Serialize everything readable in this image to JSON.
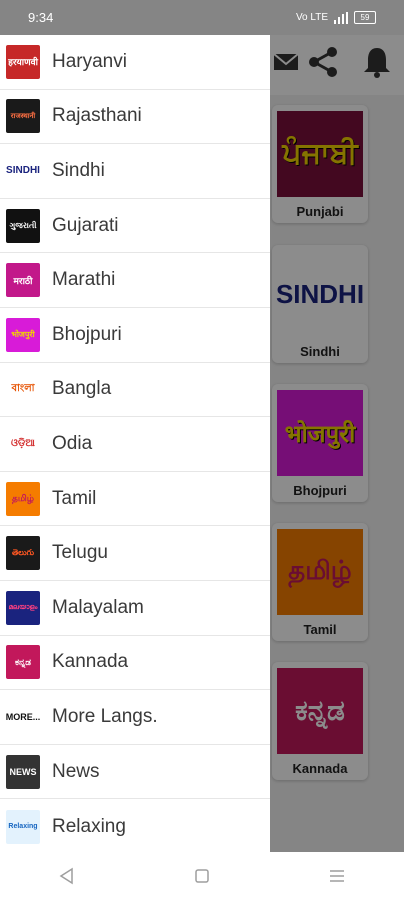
{
  "status_bar": {
    "time": "9:34",
    "signal_text": "Vo LTE",
    "battery_text": "59"
  },
  "drawer": {
    "items": [
      {
        "label": "Haryanvi",
        "icon": "haryanvi-icon",
        "icon_text": "हरयाणवी",
        "color": "#c62828"
      },
      {
        "label": "Rajasthani",
        "icon": "rajasthani-icon",
        "icon_text": "राजस्थानी",
        "color": "#1a1a1a"
      },
      {
        "label": "Sindhi",
        "icon": "sindhi-icon",
        "icon_text": "SINDHI",
        "color": "#ffffff"
      },
      {
        "label": "Gujarati",
        "icon": "gujarati-icon",
        "icon_text": "ગુજરાતી",
        "color": "#111111"
      },
      {
        "label": "Marathi",
        "icon": "marathi-icon",
        "icon_text": "मराठी",
        "color": "#c2188a"
      },
      {
        "label": "Bhojpuri",
        "icon": "bhojpuri-icon",
        "icon_text": "भोजपुरी",
        "color": "#d81bd8"
      },
      {
        "label": "Bangla",
        "icon": "bangla-icon",
        "icon_text": "বাংলা",
        "color": "#ffffff"
      },
      {
        "label": "Odia",
        "icon": "odia-icon",
        "icon_text": "ଓଡ଼ିଆ",
        "color": "#ffffff"
      },
      {
        "label": "Tamil",
        "icon": "tamil-icon",
        "icon_text": "தமிழ்",
        "color": "#f57c00"
      },
      {
        "label": "Telugu",
        "icon": "telugu-icon",
        "icon_text": "తెలుగు",
        "color": "#1a1a1a"
      },
      {
        "label": "Malayalam",
        "icon": "malayalam-icon",
        "icon_text": "മലയാളം",
        "color": "#1a237e"
      },
      {
        "label": "Kannada",
        "icon": "kannada-icon",
        "icon_text": "ಕನ್ನಡ",
        "color": "#c2185b"
      },
      {
        "label": "More Langs.",
        "icon": "more-langs-icon",
        "icon_text": "MORE...",
        "color": "#ffffff"
      },
      {
        "label": "News",
        "icon": "news-icon",
        "icon_text": "NEWS",
        "color": "#333333"
      },
      {
        "label": "Relaxing",
        "icon": "relaxing-icon",
        "icon_text": "Relaxing",
        "color": "#e3f2fd"
      }
    ]
  },
  "background": {
    "cards": [
      {
        "label": "Punjabi",
        "tile_text": "ਪੰਜਾਬੀ",
        "tile_color": "#7a0f3b",
        "text_color": "#f2d400"
      },
      {
        "label": "Sindhi",
        "tile_text": "SINDHI",
        "tile_color": "#ffffff",
        "text_color": "#1a237e"
      },
      {
        "label": "Bhojpuri",
        "tile_text": "भोजपुरी",
        "tile_color": "#d81bd8",
        "text_color": "#f2d400"
      },
      {
        "label": "Tamil",
        "tile_text": "தமிழ்",
        "tile_color": "#f57c00",
        "text_color": "#c2185b"
      },
      {
        "label": "Kannada",
        "tile_text": "ಕನ್ನಡ",
        "tile_color": "#c2185b",
        "text_color": "#ffffff"
      }
    ]
  },
  "navigation": {
    "back_icon": "back-triangle-icon",
    "home_icon": "home-square-icon",
    "menu_icon": "menu-lines-icon"
  }
}
